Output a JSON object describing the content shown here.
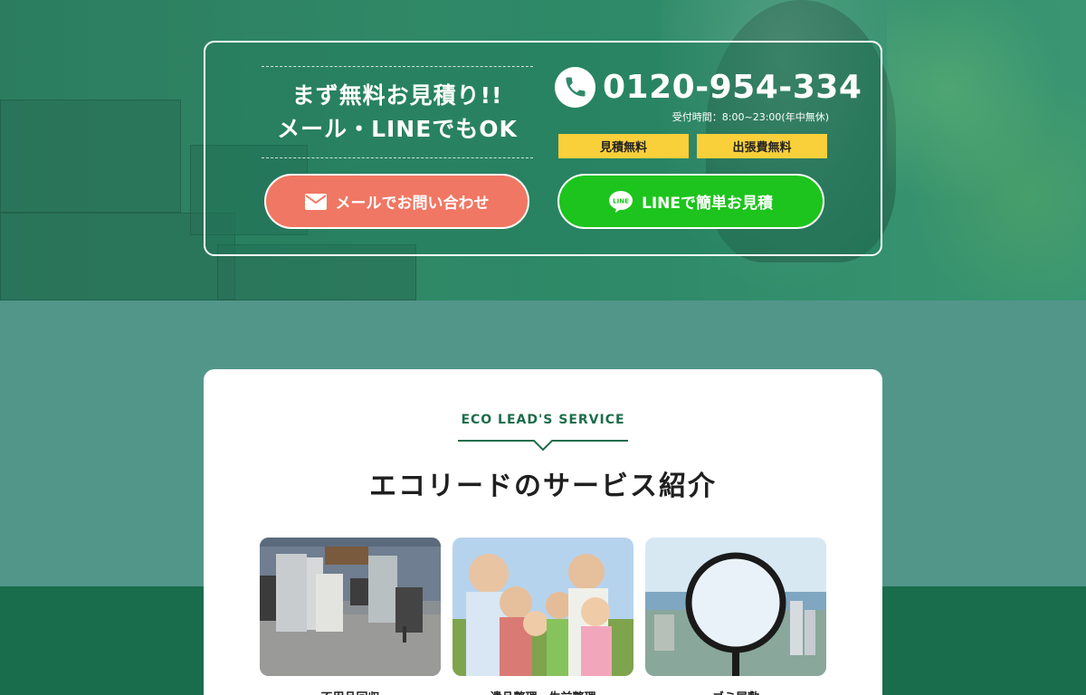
{
  "cta": {
    "headline_line1": "まず無料お見積り!!",
    "headline_line2": "メール・LINEでもOK",
    "mail_button_label": "メールでお問い合わせ",
    "line_button_label": "LINEで簡単お見積",
    "line_icon_text": "LINE",
    "phone_number": "0120-954-334",
    "hours": "受付時間：8:00~23:00(年中無休)",
    "badges": [
      "見積無料",
      "出張費無料"
    ]
  },
  "service": {
    "eyebrow": "ECO LEAD'S SERVICE",
    "title": "エコリードのサービス紹介",
    "items": [
      {
        "label": "不用品回収"
      },
      {
        "label": "遺品整理・生前整理"
      },
      {
        "label": "ゴミ屋敷"
      }
    ]
  },
  "colors": {
    "brand_green": "#196d4c",
    "mail_button": "#f07763",
    "line_button": "#1dc41d",
    "badge": "#f9cf3a"
  }
}
